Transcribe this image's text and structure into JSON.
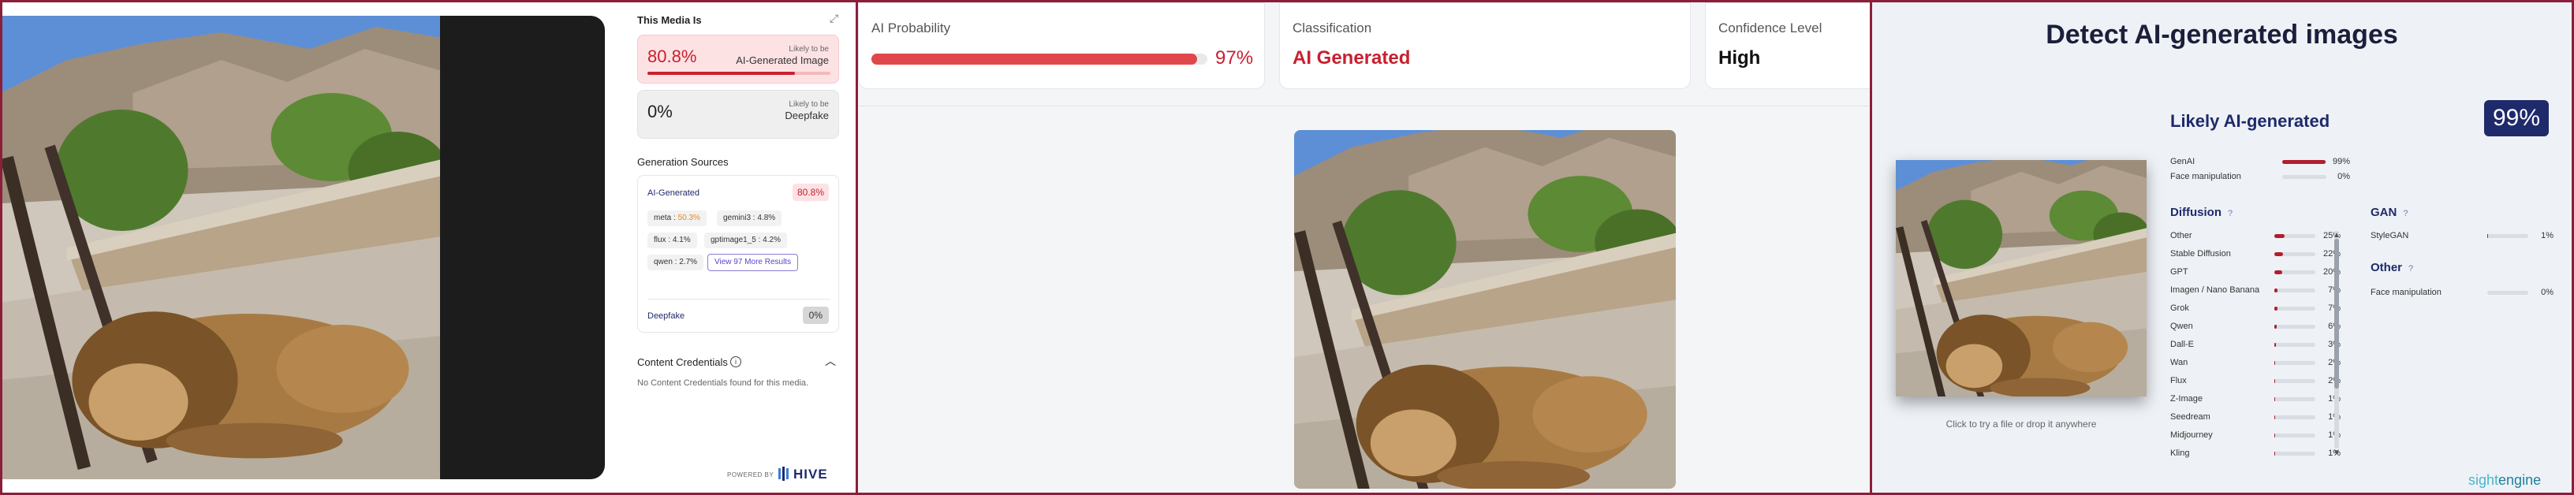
{
  "hive": {
    "header": "This Media Is",
    "ai_card": {
      "percent": "80.8%",
      "small_label": "Likely to be",
      "label": "AI-Generated Image",
      "bar_fraction": 0.808
    },
    "deepfake_card": {
      "percent": "0%",
      "small_label": "Likely to be",
      "label": "Deepfake"
    },
    "sources_title": "Generation Sources",
    "sources_head": "AI-Generated",
    "sources_badge": "80.8%",
    "chips": [
      {
        "name": "meta :",
        "value": "50.3%"
      },
      {
        "name": "gemini3 :",
        "value": "4.8%"
      },
      {
        "name": "flux :",
        "value": "4.1%"
      },
      {
        "name": "gptimage1_5 :",
        "value": "4.2%"
      },
      {
        "name": "qwen :",
        "value": "2.7%"
      }
    ],
    "more_results": "View 97 More Results",
    "deepfake_label": "Deepfake",
    "deepfake_badge": "0%",
    "credentials_title": "Content Credentials",
    "credentials_text": "No Content Credentials found for this media.",
    "powered_by": "POWERED BY",
    "brand": "HIVE"
  },
  "detector2": {
    "probability_label": "AI Probability",
    "probability_value": "97%",
    "probability_fraction": 0.97,
    "classification_label": "Classification",
    "classification_value": "AI Generated",
    "confidence_label": "Confidence Level",
    "confidence_value": "High"
  },
  "sightengine": {
    "title": "Detect AI-generated images",
    "verdict": "Likely AI-generated",
    "score": "99%",
    "hint": "Click to try a file or drop it anywhere",
    "summary": [
      {
        "label": "GenAI",
        "value": "99%",
        "fraction": 0.99
      },
      {
        "label": "Face manipulation",
        "value": "0%",
        "fraction": 0.0
      }
    ],
    "diffusion_title": "Diffusion",
    "diffusion": [
      {
        "label": "Other",
        "value": "25%",
        "fraction": 0.25
      },
      {
        "label": "Stable Diffusion",
        "value": "22%",
        "fraction": 0.22
      },
      {
        "label": "GPT",
        "value": "20%",
        "fraction": 0.2
      },
      {
        "label": "Imagen / Nano Banana",
        "value": "7%",
        "fraction": 0.07
      },
      {
        "label": "Grok",
        "value": "7%",
        "fraction": 0.07
      },
      {
        "label": "Qwen",
        "value": "6%",
        "fraction": 0.06
      },
      {
        "label": "Dall-E",
        "value": "3%",
        "fraction": 0.03
      },
      {
        "label": "Wan",
        "value": "2%",
        "fraction": 0.02
      },
      {
        "label": "Flux",
        "value": "2%",
        "fraction": 0.02
      },
      {
        "label": "Z-Image",
        "value": "1%",
        "fraction": 0.01
      },
      {
        "label": "Seedream",
        "value": "1%",
        "fraction": 0.01
      },
      {
        "label": "Midjourney",
        "value": "1%",
        "fraction": 0.01
      },
      {
        "label": "Kling",
        "value": "1%",
        "fraction": 0.01
      }
    ],
    "gan_title": "GAN",
    "gan": [
      {
        "label": "StyleGAN",
        "value": "1%",
        "fraction": 0.01
      }
    ],
    "other_title": "Other",
    "other": [
      {
        "label": "Face manipulation",
        "value": "0%",
        "fraction": 0.0
      }
    ],
    "brand_light": "sight",
    "brand_dark": "engine"
  },
  "colors": {
    "accent_red": "#c8202f",
    "navy": "#1f2a6b",
    "frame": "#8c1e3a",
    "brand_teal": "#4bb5c9"
  },
  "icons": [
    "share-icon",
    "info-icon",
    "chevron-up-icon",
    "help-icon",
    "scroll-up-icon",
    "scroll-down-icon",
    "hive-logo-icon"
  ]
}
